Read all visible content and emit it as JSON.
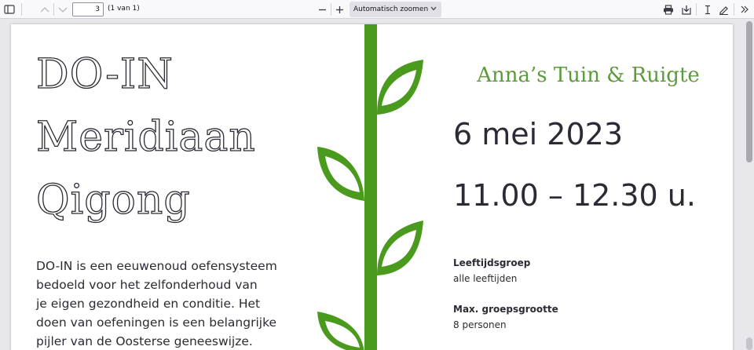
{
  "toolbar": {
    "page_number": "3",
    "page_count": "(1 van 1)",
    "zoom_label": "Automatisch zoomen"
  },
  "poster": {
    "title_lines": [
      "DO-IN",
      "Meridiaan",
      "Qigong"
    ],
    "intro_lines": [
      "DO-IN is een eeuwenoud oefensysteem",
      "bedoeld voor het zelfonderhoud van",
      "je eigen gezondheid en conditie. Het",
      "doen van oefeningen is een belangrijke",
      "pijler van de Oosterse geneeswijze."
    ],
    "organizer": "Anna’s Tuin & Ruigte",
    "date": "6 mei 2023",
    "time": "11.00 – 12.30 u.",
    "details": [
      {
        "label": "Leeftijdsgroep",
        "value": "alle leeftijden"
      },
      {
        "label": "Max. groepsgrootte",
        "value": "8 personen"
      }
    ]
  },
  "colors": {
    "accent_green": "#5d9a3c",
    "vine_green": "#4a9a1e",
    "text_dark": "#2b2b35"
  }
}
